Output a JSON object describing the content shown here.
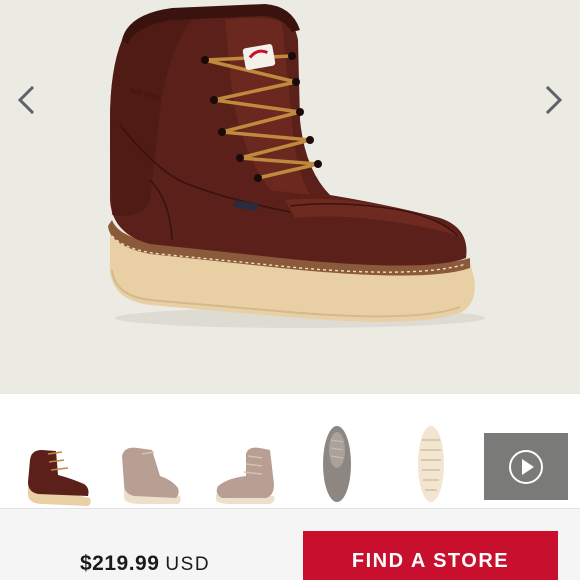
{
  "nav": {
    "prev_icon": "chevron-left-icon",
    "next_icon": "chevron-right-icon"
  },
  "product": {
    "image": "red-wing-moc-toe-work-boot",
    "thumbnails": [
      {
        "view": "side-left",
        "selected": true
      },
      {
        "view": "front-angle-faded",
        "selected": false
      },
      {
        "view": "side-right-faded",
        "selected": false
      },
      {
        "view": "top",
        "selected": false
      },
      {
        "view": "sole",
        "selected": false
      }
    ],
    "video_icon": "play-icon"
  },
  "footer": {
    "price": "$219.99",
    "currency": "USD",
    "cta_label": "FIND A STORE"
  },
  "colors": {
    "hero_bg": "#ecebe3",
    "leather": "#5a2019",
    "sole": "#e8cfa4",
    "cta": "#c8102e",
    "video_bg": "#7a7a78"
  }
}
